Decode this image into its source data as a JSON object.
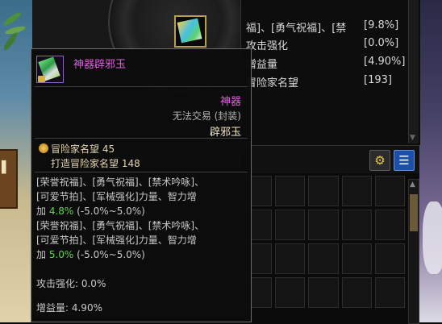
{
  "stats_panel": {
    "rows": [
      {
        "name": "福]、[勇气祝福]、[禁",
        "value": "[9.8%]"
      },
      {
        "name": "攻击强化",
        "value": "[0.0%]"
      },
      {
        "name": "增益量",
        "value": "[4.90%]"
      },
      {
        "name": "冒险家名望",
        "value": "[193]"
      }
    ]
  },
  "tooltip": {
    "item_name": "神器辟邪玉",
    "rarity": "神器",
    "trade_status": "无法交易 (封装)",
    "item_name_repeat": "辟邪玉",
    "fame_label": "冒险家名望",
    "fame_value": "45",
    "craft_fame_label": "打造冒险家名望",
    "craft_fame_value": "148",
    "effect_1": {
      "line1": "[荣誉祝福]、[勇气祝福]、[禁术吟咏]、",
      "line2": "[可爱节拍]、[军械强化]力量、智力增",
      "prefix": "加 ",
      "value": "4.8%",
      "range": " (-5.0%~5.0%)"
    },
    "effect_2": {
      "line1": "[荣誉祝福]、[勇气祝福]、[禁术吟咏]、",
      "line2": "[可爱节拍]、[军械强化]力量、智力增",
      "prefix": "加 ",
      "value": "5.0%",
      "range": " (-5.0%~5.0%)"
    },
    "attack_boost": "攻击强化: 0.0%",
    "buff_amount": "增益量: 4.90%"
  },
  "colors": {
    "epic_pink": "#e45ce2",
    "roll_green": "#5fd44b",
    "list_button_blue": "#1c4fa8"
  },
  "icons": {
    "item": "artifact-gem-icon",
    "lock": "lock-icon",
    "fame": "fame-medal-icon",
    "settings": "gear-icon",
    "view": "list-view-icon"
  }
}
